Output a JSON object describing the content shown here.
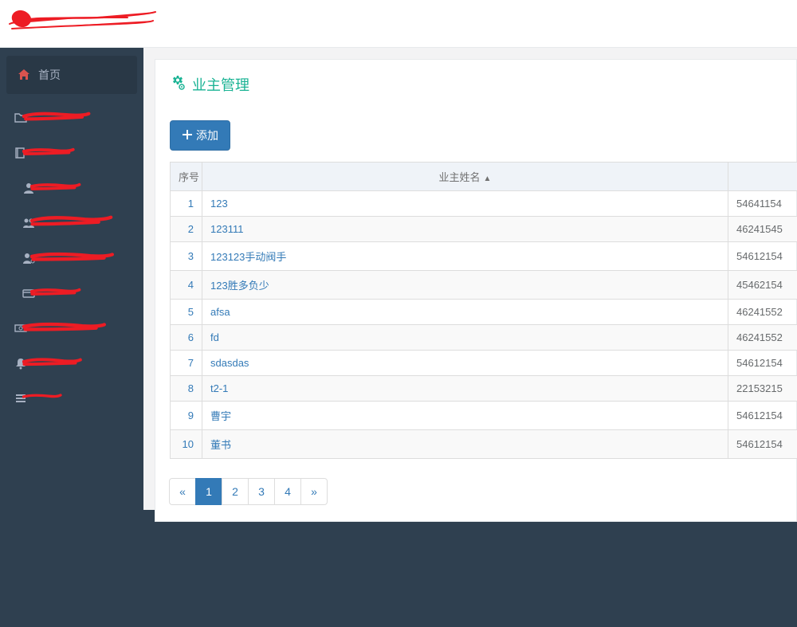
{
  "sidebar": {
    "home_label": "首页"
  },
  "page": {
    "title": "业主管理",
    "add_label": "添加"
  },
  "table": {
    "col_idx": "序号",
    "col_name": "业主姓名",
    "rows": [
      {
        "idx": "1",
        "name": "123",
        "val": "54641154"
      },
      {
        "idx": "2",
        "name": "123111",
        "val": "46241545"
      },
      {
        "idx": "3",
        "name": "123123手动阀手",
        "val": "54612154"
      },
      {
        "idx": "4",
        "name": "123胜多负少",
        "val": "45462154"
      },
      {
        "idx": "5",
        "name": "afsa",
        "val": "46241552"
      },
      {
        "idx": "6",
        "name": "fd",
        "val": "46241552"
      },
      {
        "idx": "7",
        "name": "sdasdas",
        "val": "54612154"
      },
      {
        "idx": "8",
        "name": "t2-1",
        "val": "22153215"
      },
      {
        "idx": "9",
        "name": "曹宇",
        "val": "54612154"
      },
      {
        "idx": "10",
        "name": "董书",
        "val": "54612154"
      }
    ]
  },
  "pagination": {
    "prev": "«",
    "pages": [
      "1",
      "2",
      "3",
      "4"
    ],
    "next": "»",
    "active": "1"
  }
}
